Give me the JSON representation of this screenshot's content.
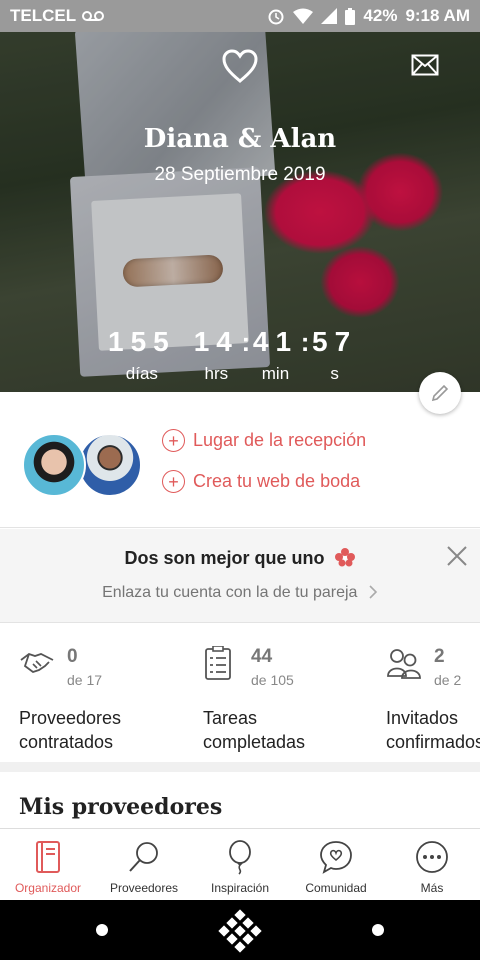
{
  "status_bar": {
    "carrier": "TELCEL",
    "battery": "42%",
    "time": "9:18 AM"
  },
  "hero": {
    "couple_names": "Diana & Alan",
    "wedding_date": "28 Septiembre 2019",
    "countdown": [
      {
        "value": "155",
        "label": "días"
      },
      {
        "value": "14",
        "label": "hrs"
      },
      {
        "value": "41",
        "label": "min"
      },
      {
        "value": "57",
        "label": "s"
      }
    ]
  },
  "couple": {
    "links": [
      {
        "label": "Lugar de la recepción"
      },
      {
        "label": "Crea tu web de boda"
      }
    ]
  },
  "promo": {
    "title": "Dos son mejor que uno",
    "subtitle": "Enlaza tu cuenta con la de tu pareja"
  },
  "stats": [
    {
      "icon": "handshake-icon",
      "value": "0",
      "of": "de 17",
      "label": "Proveedores\ncontratados"
    },
    {
      "icon": "checklist-icon",
      "value": "44",
      "of": "de 105",
      "label": "Tareas\ncompletadas"
    },
    {
      "icon": "guests-icon",
      "value": "2",
      "of": "de 2",
      "label": "Invitados\nconfirmados"
    }
  ],
  "section_title": "Mis proveedores",
  "bottom_nav": [
    {
      "label": "Organizador",
      "icon": "notebook-icon",
      "active": true
    },
    {
      "label": "Proveedores",
      "icon": "search-icon",
      "active": false
    },
    {
      "label": "Inspiración",
      "icon": "balloon-icon",
      "active": false
    },
    {
      "label": "Comunidad",
      "icon": "chat-heart-icon",
      "active": false
    },
    {
      "label": "Más",
      "icon": "more-icon",
      "active": false
    }
  ],
  "colors": {
    "accent": "#e05a5a",
    "status_bar": "#9a9a9a"
  }
}
